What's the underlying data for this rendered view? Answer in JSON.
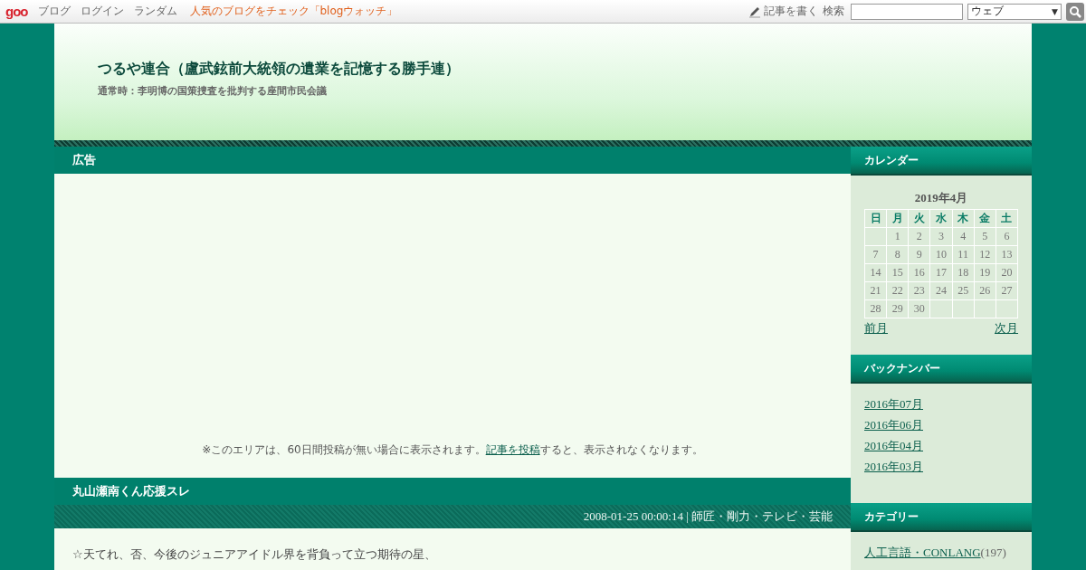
{
  "topbar": {
    "logo": "goo",
    "links": [
      "ブログ",
      "ログイン",
      "ランダム"
    ],
    "promo": "人気のブログをチェック「blogウォッチ」",
    "write": "記事を書く",
    "search_label": "検索",
    "search_scope": "ウェブ",
    "search_scope_caret": "▼"
  },
  "header": {
    "title": "つるや連合（盧武鉉前大統領の遺業を記憶する勝手連）",
    "subtitle": "通常時：李明博の国策捜査を批判する座間市民会議"
  },
  "ad": {
    "heading": "広告",
    "notice_before": "※このエリアは、60日間投稿が無い場合に表示されます。",
    "notice_link": "記事を投稿",
    "notice_after": "すると、表示されなくなります。"
  },
  "post": {
    "title": "丸山瀬南くん応援スレ",
    "meta": "2008-01-25 00:00:14 | 師匠・剛力・テレビ・芸能",
    "body": "☆天てれ、否、今後のジュニアアイドル界を背負って立つ期待の星、"
  },
  "calendar": {
    "heading": "カレンダー",
    "month": "2019年4月",
    "weekdays": [
      "日",
      "月",
      "火",
      "水",
      "木",
      "金",
      "土"
    ],
    "weeks": [
      [
        {
          "kind": "blank"
        },
        {
          "kind": "day",
          "text": "1"
        },
        {
          "kind": "day",
          "text": "2"
        },
        {
          "kind": "day",
          "text": "3"
        },
        {
          "kind": "day",
          "text": "4"
        },
        {
          "kind": "day",
          "text": "5"
        },
        {
          "kind": "day",
          "text": "6"
        }
      ],
      [
        {
          "kind": "day",
          "text": "7"
        },
        {
          "kind": "day",
          "text": "8"
        },
        {
          "kind": "day",
          "text": "9"
        },
        {
          "kind": "day",
          "text": "10"
        },
        {
          "kind": "day",
          "text": "11"
        },
        {
          "kind": "day",
          "text": "12"
        },
        {
          "kind": "day",
          "text": "13"
        }
      ],
      [
        {
          "kind": "day",
          "text": "14"
        },
        {
          "kind": "day",
          "text": "15"
        },
        {
          "kind": "day",
          "text": "16"
        },
        {
          "kind": "day",
          "text": "17"
        },
        {
          "kind": "day",
          "text": "18"
        },
        {
          "kind": "day",
          "text": "19"
        },
        {
          "kind": "day",
          "text": "20"
        }
      ],
      [
        {
          "kind": "day",
          "text": "21"
        },
        {
          "kind": "day",
          "text": "22"
        },
        {
          "kind": "day",
          "text": "23"
        },
        {
          "kind": "day",
          "text": "24"
        },
        {
          "kind": "day",
          "text": "25"
        },
        {
          "kind": "day",
          "text": "26"
        },
        {
          "kind": "day",
          "text": "27"
        }
      ],
      [
        {
          "kind": "day",
          "text": "28"
        },
        {
          "kind": "day",
          "text": "29"
        },
        {
          "kind": "day",
          "text": "30"
        },
        {
          "kind": "blank"
        },
        {
          "kind": "blank"
        },
        {
          "kind": "blank"
        },
        {
          "kind": "blank"
        }
      ]
    ],
    "prev": "前月",
    "next": "次月"
  },
  "backnumber": {
    "heading": "バックナンバー",
    "items": [
      "2016年07月",
      "2016年06月",
      "2016年04月",
      "2016年03月"
    ]
  },
  "categories": {
    "heading": "カテゴリー",
    "items": [
      {
        "name": "人工言語・CONLANG",
        "count": "(197)"
      }
    ]
  }
}
